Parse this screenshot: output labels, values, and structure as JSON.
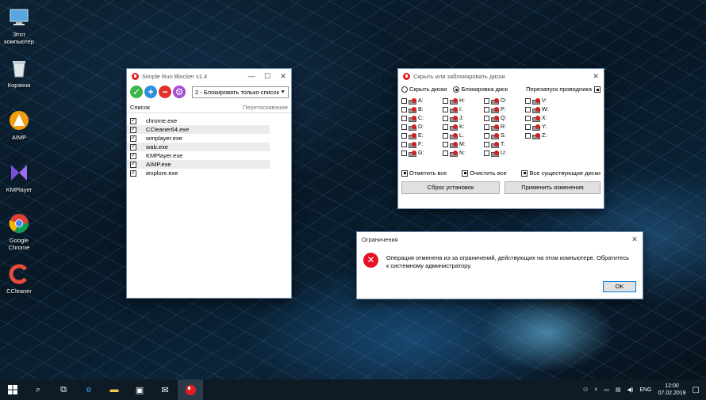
{
  "desktop": {
    "icons": [
      {
        "label": "Этот компьютер",
        "icon": "computer-icon"
      },
      {
        "label": "Корзина",
        "icon": "recycle-bin-icon"
      },
      {
        "label": "AIMP",
        "icon": "aimp-icon"
      },
      {
        "label": "KMPlayer",
        "icon": "kmplayer-icon"
      },
      {
        "label": "Google Chrome",
        "icon": "chrome-icon"
      },
      {
        "label": "CCleaner",
        "icon": "ccleaner-icon"
      }
    ]
  },
  "srb": {
    "title": "Simple Run Blocker v1.4",
    "mode": "2 - Блокировать только список",
    "list_header": "Список",
    "drag_hint": "Перетаскивание",
    "items": [
      "chrome.exe",
      "CCleaner64.exe",
      "wmplayer.exe",
      "wab.exe",
      "KMPlayer.exe",
      "AIMP.exe",
      "iexplore.exe"
    ]
  },
  "hide": {
    "title": "Скрыть или заблокировать диски",
    "opt_hide": "Скрыть диски",
    "opt_block": "Блокировка диск",
    "restart": "Перезапуск проводника",
    "drives": [
      "A:",
      "B:",
      "C:",
      "D:",
      "E:",
      "F:",
      "G:",
      "H:",
      "I:",
      "J:",
      "K:",
      "L:",
      "M:",
      "N:",
      "O:",
      "P:",
      "Q:",
      "R:",
      "S:",
      "T:",
      "U:",
      "V:",
      "W:",
      "X:",
      "Y:",
      "Z:"
    ],
    "check_all": "Отметить все",
    "clear_all": "Очистить все",
    "all_existing": "Все существующие диски",
    "reset": "Сброс установок",
    "apply": "Применить изменения"
  },
  "error": {
    "title": "Ограничения",
    "message_1": "Операция отменена из-за ограничений, действующих на этом компьютере. Обратитесь",
    "message_2": "к системному администратору.",
    "ok": "OK"
  },
  "taskbar": {
    "lang": "ENG",
    "time": "12:00",
    "date": "07.02.2019"
  }
}
